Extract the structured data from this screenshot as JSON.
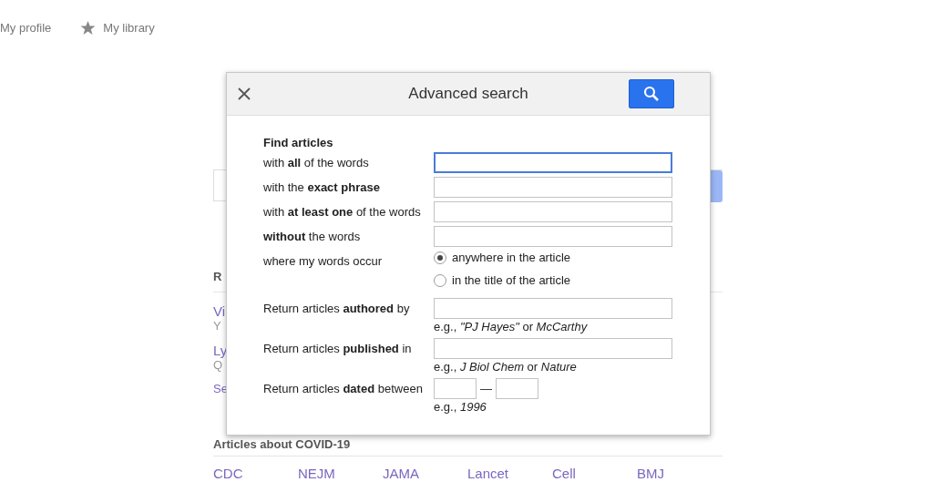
{
  "top_nav": [
    {
      "label": "My profile",
      "kind": "text"
    },
    {
      "label": "My library",
      "kind": "star"
    }
  ],
  "background": {
    "section_heading": "R",
    "results": [
      {
        "title": "Vi",
        "meta": "Y"
      },
      {
        "title": "Ly",
        "meta": "Q"
      }
    ],
    "see_more": "Se",
    "articles_heading": "Articles about COVID-19",
    "links": [
      "CDC",
      "NEJM",
      "JAMA",
      "Lancet",
      "Cell",
      "BMJ"
    ]
  },
  "dialog": {
    "title": "Advanced search",
    "find_heading": "Find articles",
    "fields": [
      {
        "label": "with **all** of the words",
        "focused": true
      },
      {
        "label": "with the **exact phrase**",
        "focused": false
      },
      {
        "label": "with **at least one** of the words",
        "focused": false
      },
      {
        "label": "**without** the words",
        "focused": false
      }
    ],
    "occur": {
      "label": "where my words occur",
      "options": [
        {
          "label": "anywhere in the article",
          "selected": true
        },
        {
          "label": "in the title of the article",
          "selected": false
        }
      ]
    },
    "return_fields": [
      {
        "kind": "text",
        "label": "Return articles **authored** by",
        "hint": "e.g., *\"PJ Hayes\"* or *McCarthy*"
      },
      {
        "kind": "text",
        "label": "Return articles **published** in",
        "hint": "e.g., *J Biol Chem* or *Nature*"
      },
      {
        "kind": "range",
        "label": "Return articles **dated** between",
        "separator": "—",
        "hint": "e.g., *1996*"
      }
    ]
  }
}
